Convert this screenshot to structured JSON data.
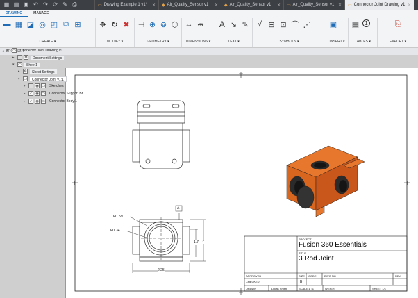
{
  "title_bar": {
    "tabs": [
      {
        "label": "Drawing Example 1 v1*",
        "active": false
      },
      {
        "label": "Air_Quality_Sensor v1",
        "active": false
      },
      {
        "label": "Air_Quality_Sensor v1",
        "active": false
      },
      {
        "label": "Air_Quality_Sensor v1",
        "active": false
      },
      {
        "label": "Connector Joint Drawing v1",
        "active": true
      }
    ]
  },
  "ribbon": {
    "tabs": [
      {
        "label": "DRAWING",
        "active": true
      },
      {
        "label": "MANAGE",
        "active": false
      }
    ],
    "groups": {
      "create": "CREATE ▾",
      "modify": "MODIFY ▾",
      "geometry": "GEOMETRY ▾",
      "dimensions": "DIMENSIONS ▾",
      "text": "TEXT ▾",
      "symbols": "SYMBOLS ▾",
      "insert": "INSERT ▾",
      "tables": "TABLES ▾",
      "export": "EXPORT ▾"
    },
    "text_icon": "A",
    "tables_icon": "1"
  },
  "browser": {
    "header": "BROWSER",
    "root": "Connector Joint Drawing v1",
    "document_settings": "Document Settings",
    "sheet": "Sheet1",
    "sheet_settings": "Sheet Settings",
    "component": "Connector Joint v1:1",
    "sketches": "Sketches",
    "support": "Connector Support Br...",
    "body": "Connector Body:1"
  },
  "drawing": {
    "dim_d1": "Ø1.59",
    "dim_d2": "Ø1.34",
    "dim_w": "2.25",
    "dim_h1": "1.7",
    "dim_h2": "2",
    "datum": "A",
    "body_color": "#e8772e"
  },
  "title_block": {
    "project_label": "PROJECT",
    "project": "Fusion 360 Essentials",
    "title_label": "TITLE",
    "title": "3 Rod Joint",
    "approved": "APPROVED",
    "checked": "CHECKED",
    "drawn": "DRAWN",
    "drawn_by": "Lucas Smith",
    "size_label": "SIZE",
    "size": "B",
    "code_label": "CODE",
    "dwg_label": "DWG NO",
    "rev_label": "REV",
    "scale": "SCALE 1 : 1",
    "weight": "WEIGHT",
    "sheet": "SHEET 1/1"
  }
}
